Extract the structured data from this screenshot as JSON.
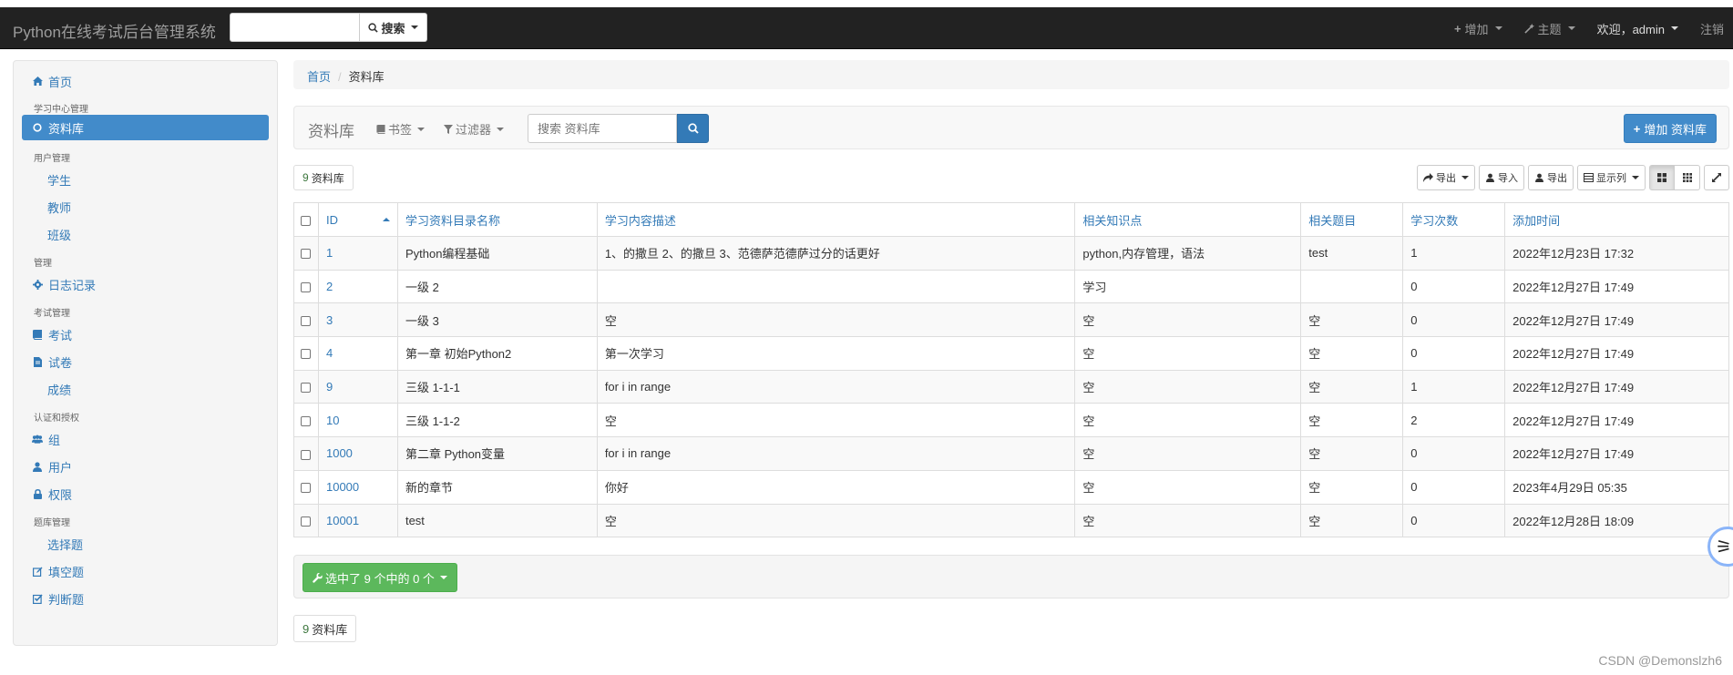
{
  "navbar": {
    "brand": "Python在线考试后台管理系统",
    "search_placeholder": "",
    "search_button": "搜索",
    "add_menu": "增加",
    "theme_menu": "主题",
    "user_menu": "欢迎，admin",
    "logout": "注销"
  },
  "sidebar": {
    "home": "首页",
    "sections": [
      {
        "header": "学习中心管理",
        "items": [
          {
            "label": "资料库",
            "icon": "circle-icon",
            "active": true
          }
        ]
      },
      {
        "header": "用户管理",
        "items": [
          {
            "label": "学生",
            "icon": ""
          },
          {
            "label": "教师",
            "icon": ""
          },
          {
            "label": "班级",
            "icon": ""
          }
        ]
      },
      {
        "header": "管理",
        "items": [
          {
            "label": "日志记录",
            "icon": "cog-icon"
          }
        ]
      },
      {
        "header": "考试管理",
        "items": [
          {
            "label": "考试",
            "icon": "book-icon"
          },
          {
            "label": "试卷",
            "icon": "file-icon"
          },
          {
            "label": "成绩",
            "icon": ""
          }
        ]
      },
      {
        "header": "认证和授权",
        "items": [
          {
            "label": "组",
            "icon": "group-icon"
          },
          {
            "label": "用户",
            "icon": "user-icon"
          },
          {
            "label": "权限",
            "icon": "lock-icon"
          }
        ]
      },
      {
        "header": "题库管理",
        "items": [
          {
            "label": "选择题",
            "icon": ""
          },
          {
            "label": "填空题",
            "icon": "edit-icon"
          },
          {
            "label": "判断题",
            "icon": "check-square-icon"
          }
        ]
      }
    ]
  },
  "breadcrumb": {
    "home": "首页",
    "current": "资料库"
  },
  "panel": {
    "title": "资料库",
    "bookmarks": "书签",
    "filters": "过滤器",
    "search_placeholder": "搜索 资料库",
    "add_button": "增加 资料库"
  },
  "count": {
    "number": "9",
    "label": "资料库"
  },
  "toolbar": {
    "export_menu": "导出",
    "import": "导入",
    "export": "导出",
    "columns": "显示列"
  },
  "table": {
    "headers": [
      "ID",
      "学习资料目录名称",
      "学习内容描述",
      "相关知识点",
      "相关题目",
      "学习次数",
      "添加时间"
    ],
    "rows": [
      [
        "1",
        "Python编程基础",
        "1、的撒旦 2、的撒旦 3、范德萨范德萨过分的话更好",
        "python,内存管理，语法",
        "test",
        "1",
        "2022年12月23日 17:32"
      ],
      [
        "2",
        "一级 2",
        "",
        "学习",
        "",
        "0",
        "2022年12月27日 17:49"
      ],
      [
        "3",
        "一级 3",
        "空",
        "空",
        "空",
        "0",
        "2022年12月27日 17:49"
      ],
      [
        "4",
        "第一章 初始Python2",
        "第一次学习",
        "空",
        "空",
        "0",
        "2022年12月27日 17:49"
      ],
      [
        "9",
        "三级 1-1-1",
        "for i in range",
        "空",
        "空",
        "1",
        "2022年12月27日 17:49"
      ],
      [
        "10",
        "三级 1-1-2",
        "空",
        "空",
        "空",
        "2",
        "2022年12月27日 17:49"
      ],
      [
        "1000",
        "第二章 Python变量",
        "for i in range",
        "空",
        "空",
        "0",
        "2022年12月27日 17:49"
      ],
      [
        "10000",
        "新的章节",
        "你好",
        "空",
        "空",
        "0",
        "2023年4月29日 05:35"
      ],
      [
        "10001",
        "test",
        "空",
        "空",
        "空",
        "0",
        "2022年12月28日 18:09"
      ]
    ]
  },
  "actions": {
    "selected_label": "选中了 9 个中的 0 个"
  },
  "watermark": "CSDN @Demonslzh6"
}
